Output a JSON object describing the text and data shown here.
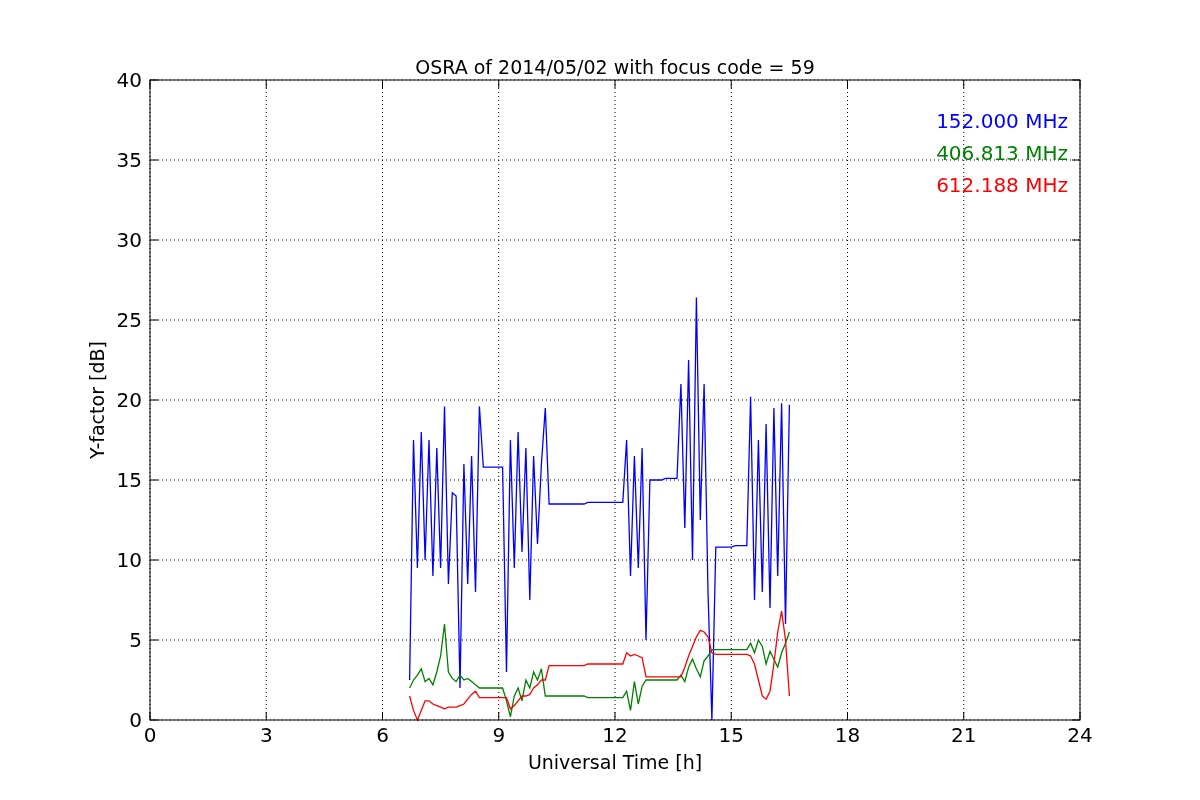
{
  "chart_data": {
    "type": "line",
    "grid": true,
    "title": "OSRA of 2014/05/02 with focus code = 59",
    "xlabel": "Universal Time [h]",
    "ylabel": "Y-factor [dB]",
    "xlim": [
      0,
      24
    ],
    "ylim": [
      0,
      40
    ],
    "xticks": [
      0,
      3,
      6,
      9,
      12,
      15,
      18,
      21,
      24
    ],
    "yticks": [
      0,
      5,
      10,
      15,
      20,
      25,
      30,
      35,
      40
    ],
    "x": [
      6.7,
      6.8,
      6.9,
      7.0,
      7.1,
      7.2,
      7.3,
      7.4,
      7.5,
      7.6,
      7.7,
      7.8,
      7.9,
      8.0,
      8.1,
      8.2,
      8.3,
      8.4,
      8.5,
      8.6,
      8.7,
      8.8,
      8.9,
      9.0,
      9.1,
      9.2,
      9.3,
      9.4,
      9.5,
      9.6,
      9.7,
      9.8,
      9.9,
      10.0,
      10.1,
      10.2,
      10.3,
      10.4,
      10.5,
      10.6,
      10.7,
      10.8,
      10.9,
      11.0,
      11.1,
      11.2,
      11.3,
      11.4,
      11.5,
      11.6,
      11.7,
      11.8,
      11.9,
      12.0,
      12.1,
      12.2,
      12.3,
      12.4,
      12.5,
      12.6,
      12.7,
      12.8,
      12.9,
      13.0,
      13.1,
      13.2,
      13.3,
      13.4,
      13.5,
      13.6,
      13.7,
      13.8,
      13.9,
      14.0,
      14.1,
      14.2,
      14.3,
      14.4,
      14.5,
      14.6,
      14.7,
      14.8,
      14.9,
      15.0,
      15.1,
      15.2,
      15.3,
      15.4,
      15.5,
      15.6,
      15.7,
      15.8,
      15.9,
      16.0,
      16.1,
      16.2,
      16.3,
      16.4,
      16.5
    ],
    "series": [
      {
        "name": "152.000 MHz",
        "color": "#0000ff",
        "values": [
          2.5,
          17.5,
          9.5,
          18,
          10,
          17.5,
          9,
          17,
          9.5,
          19.6,
          8.5,
          14.2,
          14,
          2,
          16,
          8.5,
          16.5,
          8,
          19.6,
          15.8,
          15.8,
          15.8,
          15.8,
          15.8,
          15.8,
          3,
          17.5,
          9.5,
          18,
          10.5,
          17,
          7.5,
          16.5,
          11,
          16,
          19.5,
          13.5,
          13.5,
          13.5,
          13.5,
          13.5,
          13.5,
          13.5,
          13.5,
          13.5,
          13.5,
          13.6,
          13.6,
          13.6,
          13.6,
          13.6,
          13.6,
          13.6,
          13.6,
          13.6,
          13.6,
          17.5,
          9,
          16.5,
          9.5,
          17,
          5,
          15,
          15,
          15,
          15,
          15.1,
          15.1,
          15.1,
          15.1,
          21,
          12,
          22.5,
          10,
          26.4,
          12.5,
          21,
          8,
          0,
          10.8,
          10.8,
          10.8,
          10.8,
          10.8,
          10.9,
          10.9,
          10.9,
          10.9,
          20.2,
          7.5,
          17.5,
          8,
          18.5,
          7,
          19.5,
          9,
          19.8,
          6,
          19.7
        ]
      },
      {
        "name": "406.813 MHz",
        "color": "#008000",
        "values": [
          2,
          2.5,
          2.8,
          3.2,
          2.4,
          2.6,
          2.2,
          3,
          4,
          6,
          3,
          2.6,
          2.4,
          2.8,
          2.5,
          2.6,
          2.4,
          2.2,
          2,
          2,
          2,
          2,
          2,
          2,
          2,
          1.2,
          0.2,
          1.5,
          2,
          1.2,
          2.5,
          2,
          3,
          2.5,
          3.2,
          1.5,
          1.5,
          1.5,
          1.5,
          1.5,
          1.5,
          1.5,
          1.5,
          1.5,
          1.5,
          1.5,
          1.4,
          1.4,
          1.4,
          1.4,
          1.4,
          1.4,
          1.4,
          1.4,
          1.4,
          1.4,
          1.8,
          0.6,
          2.4,
          1,
          2.1,
          2.5,
          2.5,
          2.5,
          2.5,
          2.5,
          2.5,
          2.5,
          2.5,
          2.5,
          2.8,
          2.4,
          3.3,
          3.8,
          3.2,
          2.7,
          3.7,
          4,
          4.4,
          4.4,
          4.4,
          4.4,
          4.4,
          4.4,
          4.4,
          4.4,
          4.4,
          4.4,
          4.8,
          4.2,
          5,
          4.6,
          3.5,
          4.3,
          3.8,
          3.3,
          4.2,
          4.8,
          5.5
        ]
      },
      {
        "name": "612.188 MHz",
        "color": "#ff0000",
        "values": [
          1.5,
          0.6,
          0,
          0.6,
          1.2,
          1.2,
          1,
          0.9,
          0.8,
          0.7,
          0.8,
          0.8,
          0.8,
          0.9,
          1,
          1.3,
          1.6,
          1.8,
          1.4,
          1.4,
          1.4,
          1.4,
          1.4,
          1.4,
          1.4,
          1.4,
          0.7,
          0.9,
          1.2,
          1.5,
          1.5,
          1.6,
          2,
          2.2,
          2.5,
          2.5,
          3.4,
          3.4,
          3.4,
          3.4,
          3.4,
          3.4,
          3.4,
          3.4,
          3.4,
          3.4,
          3.5,
          3.5,
          3.5,
          3.5,
          3.5,
          3.5,
          3.5,
          3.5,
          3.5,
          3.5,
          4.2,
          4,
          4.1,
          4,
          3.9,
          2.7,
          2.7,
          2.7,
          2.7,
          2.7,
          2.7,
          2.7,
          2.7,
          2.7,
          2.7,
          3.3,
          4,
          4.6,
          5.2,
          5.6,
          5.5,
          5.2,
          4.2,
          4.1,
          4.1,
          4.1,
          4.1,
          4.1,
          4.1,
          4.1,
          4.1,
          4.1,
          4,
          3.5,
          2.5,
          1.5,
          1.3,
          1.8,
          3.5,
          5.5,
          6.8,
          5,
          1.5
        ]
      }
    ]
  }
}
